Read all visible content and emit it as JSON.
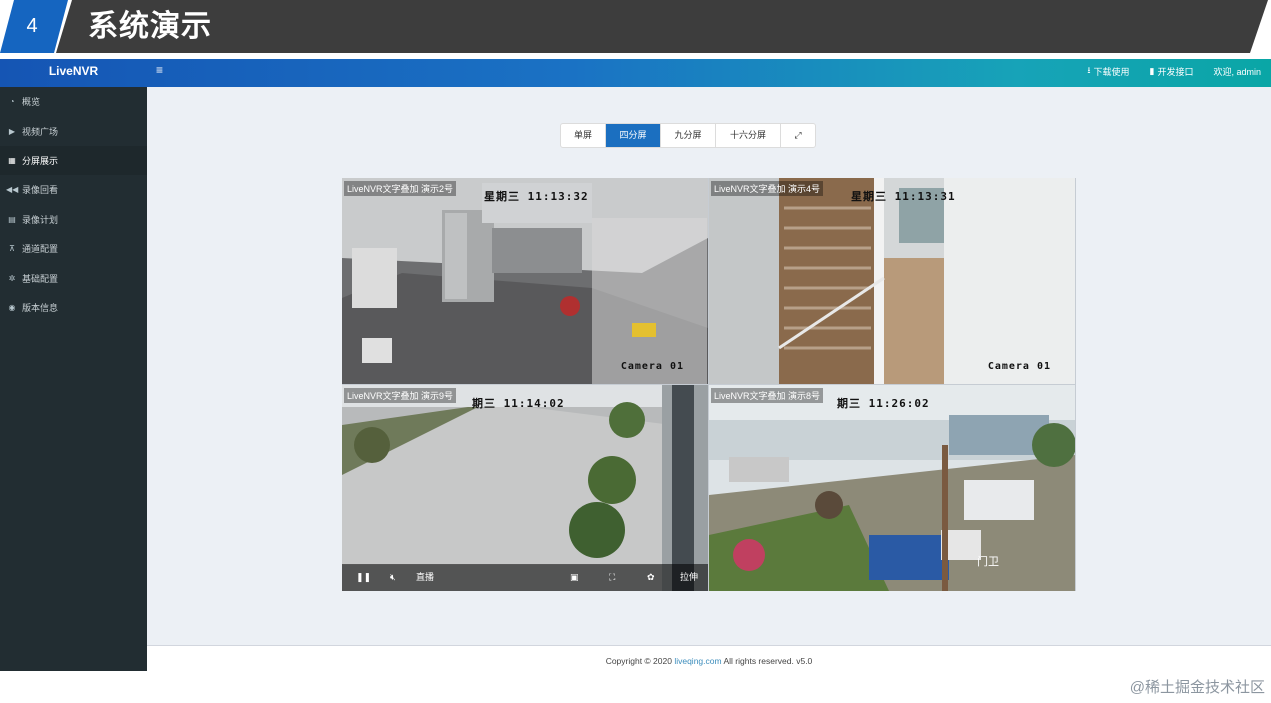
{
  "slide": {
    "number": "4",
    "title": "系统演示"
  },
  "app": {
    "logo": "LiveNVR",
    "menu_toggle": "≡",
    "top_links": [
      {
        "icon": "download-icon",
        "glyph": "⭳",
        "label": "下载使用"
      },
      {
        "icon": "book-icon",
        "glyph": "▮",
        "label": "开发接口"
      }
    ],
    "welcome": "欢迎, admin"
  },
  "sidebar": {
    "items": [
      {
        "icon": "dashboard-icon",
        "glyph": "◔",
        "label": "概览",
        "active": false
      },
      {
        "icon": "play-icon",
        "glyph": "▶",
        "label": "视频广场",
        "active": false
      },
      {
        "icon": "grid-icon",
        "glyph": "▦",
        "label": "分屏展示",
        "active": true
      },
      {
        "icon": "backward-icon",
        "glyph": "◀◀",
        "label": "录像回看",
        "active": false
      },
      {
        "icon": "calendar-icon",
        "glyph": "▤",
        "label": "录像计划",
        "active": false
      },
      {
        "icon": "sitemap-icon",
        "glyph": "⊼",
        "label": "通道配置",
        "active": false
      },
      {
        "icon": "gear-icon",
        "glyph": "✲",
        "label": "基础配置",
        "active": false
      },
      {
        "icon": "info-icon",
        "glyph": "◉",
        "label": "版本信息",
        "active": false
      }
    ]
  },
  "split_buttons": [
    {
      "label": "单屏",
      "active": false
    },
    {
      "label": "四分屏",
      "active": true
    },
    {
      "label": "九分屏",
      "active": false
    },
    {
      "label": "十六分屏",
      "active": false
    },
    {
      "label": "⤢",
      "icon": "fullscreen-icon",
      "active": false
    }
  ],
  "tiles": [
    {
      "label": "LiveNVR文字叠加 演示2号",
      "timestamp": "星期三  11:13:32",
      "camera": "Camera 01"
    },
    {
      "label": "LiveNVR文字叠加 演示4号",
      "timestamp": "星期三  11:13:31",
      "camera": "Camera 01"
    },
    {
      "label": "LiveNVR文字叠加 演示9号",
      "timestamp": "期三  11:14:02",
      "camera": ""
    },
    {
      "label": "LiveNVR文字叠加 演示8号",
      "timestamp": "期三  11:26:02",
      "camera": "",
      "overlay": "门卫"
    }
  ],
  "player_controls": {
    "pause_icon": "❚❚",
    "mute_icon": "🔇︎",
    "live_label": "直播",
    "pip_icon": "▣",
    "fullscreen_icon": "⛶",
    "snapshot_icon": "✿",
    "stretch_label": "拉伸"
  },
  "footer": {
    "prefix": "Copyright © 2020 ",
    "link": "liveqing.com",
    "suffix": " All rights reserved. v5.0"
  },
  "watermark": "@稀土掘金技术社区"
}
